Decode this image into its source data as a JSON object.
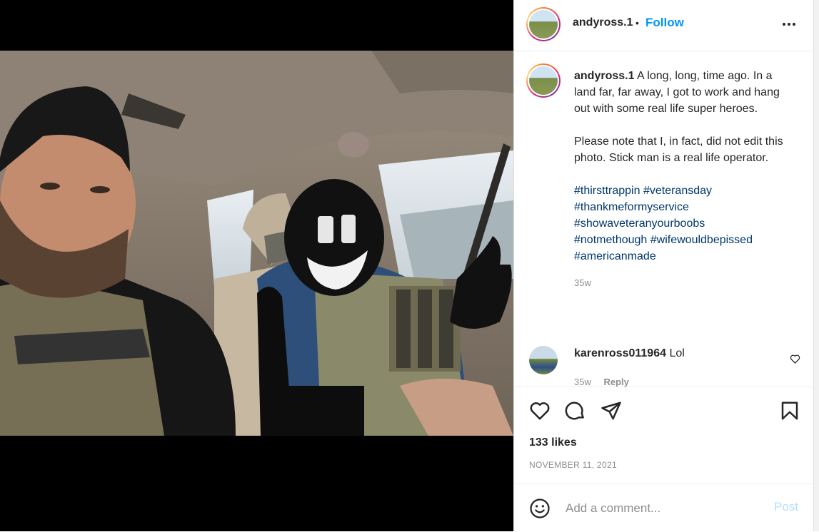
{
  "post": {
    "username": "andyross.1",
    "follow_label": "Follow",
    "more_icon": "more-horizontal-icon"
  },
  "caption": {
    "username": "andyross.1",
    "text1": "A long, long, time ago. In a land far, far away, I got to work and hang out with some real life super heroes.",
    "text2": "Please note that I, in fact, did not edit this photo. Stick man is a real life operator.",
    "hashtags": [
      "#thirsttrappin",
      "#veteransday",
      "#thankmeformyservice",
      "#showaveteranyourboobs",
      "#notmethough",
      "#wifewouldbepissed",
      "#americanmade"
    ],
    "time": "35w"
  },
  "comment": {
    "username": "karenross011964",
    "text": "Lol",
    "time": "35w",
    "reply_label": "Reply"
  },
  "actions": {
    "likes": "133 likes",
    "date": "NOVEMBER 11, 2021"
  },
  "add_comment": {
    "placeholder": "Add a comment...",
    "post_label": "Post"
  },
  "colors": {
    "accent": "#0095f6",
    "hashtag": "#00376b",
    "muted": "#8e8e8e",
    "post_disabled": "#b2dffc"
  }
}
